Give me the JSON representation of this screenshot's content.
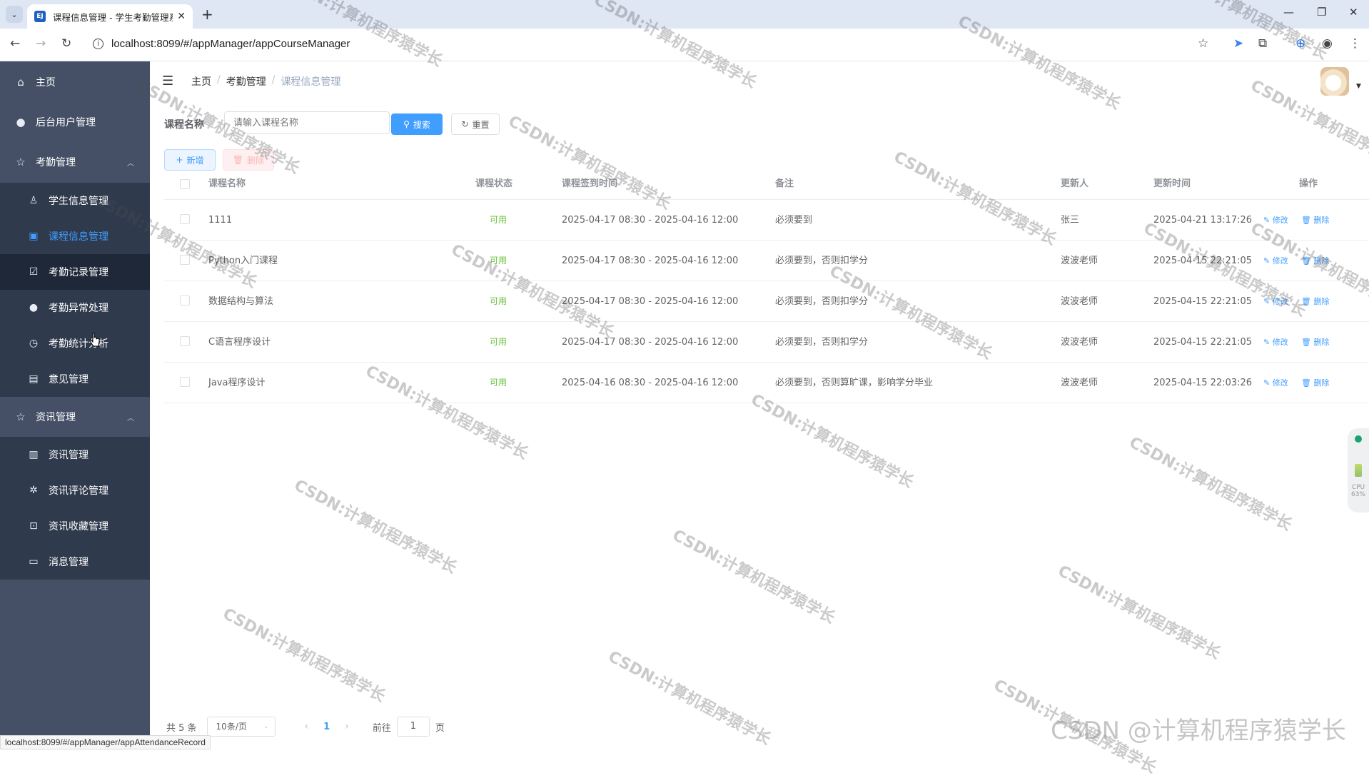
{
  "browser": {
    "tab_title": "课程信息管理 - 学生考勤管理系",
    "favicon_text": "EJ",
    "url": "localhost:8099/#/appManager/appCourseManager",
    "status_url": "localhost:8099/#/appManager/appAttendanceRecord"
  },
  "sidebar": {
    "top_items": [
      {
        "label": "主页",
        "icon": "home-icon"
      },
      {
        "label": "后台用户管理",
        "icon": "user-icon"
      },
      {
        "label": "考勤管理",
        "icon": "star-icon"
      }
    ],
    "attendance_sub": [
      {
        "label": "学生信息管理",
        "icon": "person-icon"
      },
      {
        "label": "课程信息管理",
        "icon": "clipboard-icon"
      },
      {
        "label": "考勤记录管理",
        "icon": "clipboard-check-icon"
      },
      {
        "label": "考勤异常处理",
        "icon": "user-alert-icon"
      },
      {
        "label": "考勤统计分析",
        "icon": "clock-icon"
      },
      {
        "label": "意见管理",
        "icon": "notebook-icon"
      }
    ],
    "news_group": {
      "label": "资讯管理",
      "icon": "star-icon"
    },
    "news_sub": [
      {
        "label": "资讯管理",
        "icon": "document-icon"
      },
      {
        "label": "资讯评论管理",
        "icon": "aperture-icon"
      },
      {
        "label": "资讯收藏管理",
        "icon": "bag-icon"
      },
      {
        "label": "消息管理",
        "icon": "chat-icon"
      }
    ]
  },
  "breadcrumb": [
    "主页",
    "考勤管理",
    "课程信息管理"
  ],
  "search": {
    "label": "课程名称",
    "placeholder": "请输入课程名称",
    "search_btn": "搜索",
    "reset_btn": "重置"
  },
  "actions": {
    "add": "新增",
    "delete": "删除"
  },
  "table": {
    "headers": [
      "课程名称",
      "课程状态",
      "课程签到时间",
      "备注",
      "更新人",
      "更新时间",
      "操作"
    ],
    "rows": [
      {
        "name": "1111",
        "status": "可用",
        "time": "2025-04-17 08:30 - 2025-04-16 12:00",
        "remark": "必须要到",
        "updater": "张三",
        "updated": "2025-04-21 13:17:26"
      },
      {
        "name": "Python入门课程",
        "status": "可用",
        "time": "2025-04-17 08:30 - 2025-04-16 12:00",
        "remark": "必须要到，否则扣学分",
        "updater": "波波老师",
        "updated": "2025-04-15 22:21:05"
      },
      {
        "name": "数据结构与算法",
        "status": "可用",
        "time": "2025-04-17 08:30 - 2025-04-16 12:00",
        "remark": "必须要到，否则扣学分",
        "updater": "波波老师",
        "updated": "2025-04-15 22:21:05"
      },
      {
        "name": "C语言程序设计",
        "status": "可用",
        "time": "2025-04-17 08:30 - 2025-04-16 12:00",
        "remark": "必须要到，否则扣学分",
        "updater": "波波老师",
        "updated": "2025-04-15 22:21:05"
      },
      {
        "name": "Java程序设计",
        "status": "可用",
        "time": "2025-04-16 08:30 - 2025-04-16 12:00",
        "remark": "必须要到，否则算旷课，影响学分毕业",
        "updater": "波波老师",
        "updated": "2025-04-15 22:03:26"
      }
    ],
    "edit_label": "修改",
    "delete_label": "删除"
  },
  "pagination": {
    "total": "共 5 条",
    "page_size": "10条/页",
    "current_page": "1",
    "goto_prefix": "前往",
    "goto_value": "1",
    "goto_suffix": "页"
  },
  "watermark": {
    "text": "CSDN:计算机程序猿学长",
    "corner": "CSDN @计算机程序猿学长"
  },
  "widget": {
    "label": "CPU",
    "value": "63%"
  },
  "colors": {
    "sidebar": "#455066",
    "submenu": "#2f3a4d",
    "accent": "#409eff",
    "status_ok": "#67c23a"
  }
}
